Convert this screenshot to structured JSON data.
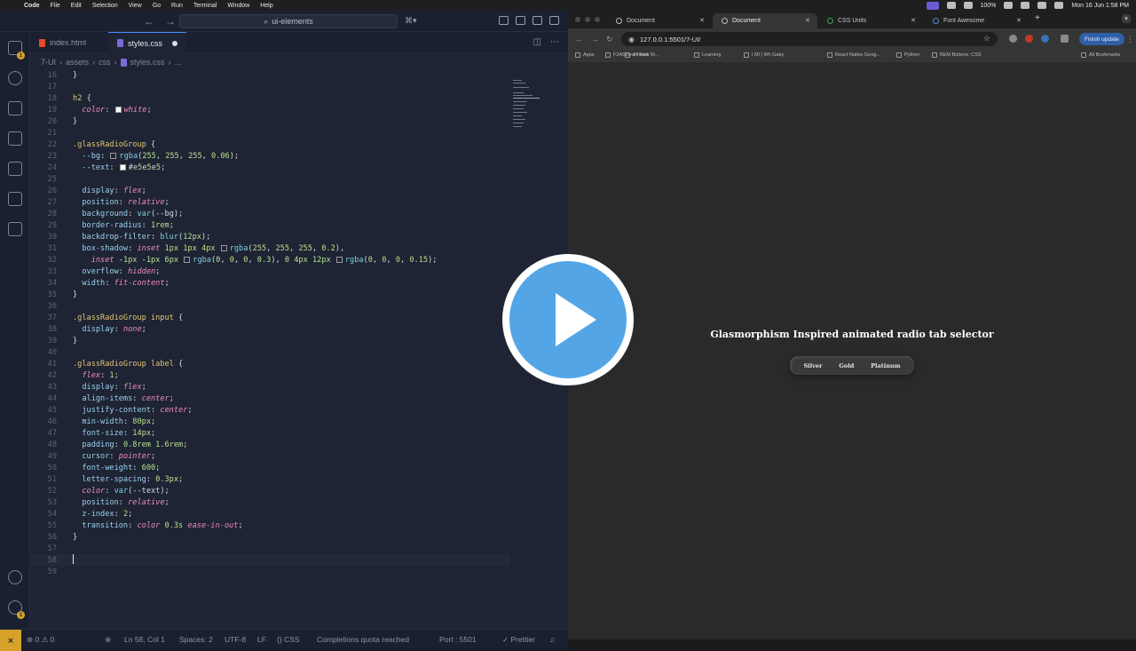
{
  "menubar": {
    "app": "Code",
    "items": [
      "File",
      "Edit",
      "Selection",
      "View",
      "Go",
      "Run",
      "Terminal",
      "Window",
      "Help"
    ],
    "battery": "100%",
    "clock": "Mon 16 Jun  1:58 PM"
  },
  "vscode": {
    "search": "ui-elements",
    "tabs": [
      {
        "label": "index.html",
        "color": "#e44d26",
        "active": false,
        "modified": false
      },
      {
        "label": "styles.css",
        "color": "#7b6bd6",
        "active": true,
        "modified": true
      }
    ],
    "breadcrumb": [
      "7-UI",
      "assets",
      "css",
      "styles.css",
      "..."
    ],
    "lines": [
      {
        "n": "16",
        "t": "}"
      },
      {
        "n": "17",
        "t": ""
      },
      {
        "n": "18",
        "t": "h2 {"
      },
      {
        "n": "19",
        "t": "  color: ■white;"
      },
      {
        "n": "20",
        "t": "}"
      },
      {
        "n": "21",
        "t": ""
      },
      {
        "n": "22",
        "t": ".glassRadioGroup {"
      },
      {
        "n": "23",
        "t": "  --bg: □rgba(255, 255, 255, 0.06);"
      },
      {
        "n": "24",
        "t": "  --text: ■#e5e5e5;"
      },
      {
        "n": "25",
        "t": ""
      },
      {
        "n": "26",
        "t": "  display: flex;"
      },
      {
        "n": "27",
        "t": "  position: relative;"
      },
      {
        "n": "28",
        "t": "  background: var(--bg);"
      },
      {
        "n": "29",
        "t": "  border-radius: 1rem;"
      },
      {
        "n": "30",
        "t": "  backdrop-filter: blur(12px);"
      },
      {
        "n": "31",
        "t": "  box-shadow: inset 1px 1px 4px □rgba(255, 255, 255, 0.2),"
      },
      {
        "n": "32",
        "t": "    inset -1px -1px 6px □rgba(0, 0, 0, 0.3), 0 4px 12px □rgba(0, 0, 0, 0.15);"
      },
      {
        "n": "33",
        "t": "  overflow: hidden;"
      },
      {
        "n": "34",
        "t": "  width: fit-content;"
      },
      {
        "n": "35",
        "t": "}"
      },
      {
        "n": "36",
        "t": ""
      },
      {
        "n": "37",
        "t": ".glassRadioGroup input {"
      },
      {
        "n": "38",
        "t": "  display: none;"
      },
      {
        "n": "39",
        "t": "}"
      },
      {
        "n": "40",
        "t": ""
      },
      {
        "n": "41",
        "t": ".glassRadioGroup label {"
      },
      {
        "n": "42",
        "t": "  flex: 1;"
      },
      {
        "n": "43",
        "t": "  display: flex;"
      },
      {
        "n": "44",
        "t": "  align-items: center;"
      },
      {
        "n": "45",
        "t": "  justify-content: center;"
      },
      {
        "n": "46",
        "t": "  min-width: 80px;"
      },
      {
        "n": "47",
        "t": "  font-size: 14px;"
      },
      {
        "n": "48",
        "t": "  padding: 0.8rem 1.6rem;"
      },
      {
        "n": "49",
        "t": "  cursor: pointer;"
      },
      {
        "n": "50",
        "t": "  font-weight: 600;"
      },
      {
        "n": "51",
        "t": "  letter-spacing: 0.3px;"
      },
      {
        "n": "52",
        "t": "  color: var(--text);"
      },
      {
        "n": "53",
        "t": "  position: relative;"
      },
      {
        "n": "54",
        "t": "  z-index: 2;"
      },
      {
        "n": "55",
        "t": "  transition: color 0.3s ease-in-out;"
      },
      {
        "n": "56",
        "t": "}"
      },
      {
        "n": "57",
        "t": ""
      },
      {
        "n": "58",
        "t": ""
      },
      {
        "n": "59",
        "t": ""
      }
    ],
    "status": {
      "problems": "⊗ 0 ⚠ 0",
      "position": "Ln 58, Col 1",
      "spaces": "Spaces: 2",
      "encoding": "UTF-8",
      "eol": "LF",
      "language": "{} CSS",
      "copilot": "Completions quota reached",
      "port": "Port : 5501",
      "prettier": "✓ Prettier"
    }
  },
  "chrome": {
    "tabs": [
      {
        "label": "Document",
        "active": false
      },
      {
        "label": "Document",
        "active": true
      },
      {
        "label": "CSS Units",
        "active": false
      },
      {
        "label": "Font Awesome",
        "active": false
      }
    ],
    "url": "127.0.0.1:5501/7-UI/",
    "finish_update": "Finish update",
    "bookmarks": [
      "Apps",
      "F2A6View - Hwk M...",
      "Affiliate",
      "Learning",
      "I Ml | Wh Gaby",
      "React Native Goog...",
      "Python",
      "BEM Buttons: CSS"
    ],
    "all_bookmarks": "All Bookmarks",
    "page": {
      "heading": "Glasmorphism Inspired animated radio tab selector",
      "options": [
        "Silver",
        "Gold",
        "Platinum"
      ]
    }
  },
  "overlay": {
    "icon": "play-icon",
    "accent": "#53a5e6"
  }
}
